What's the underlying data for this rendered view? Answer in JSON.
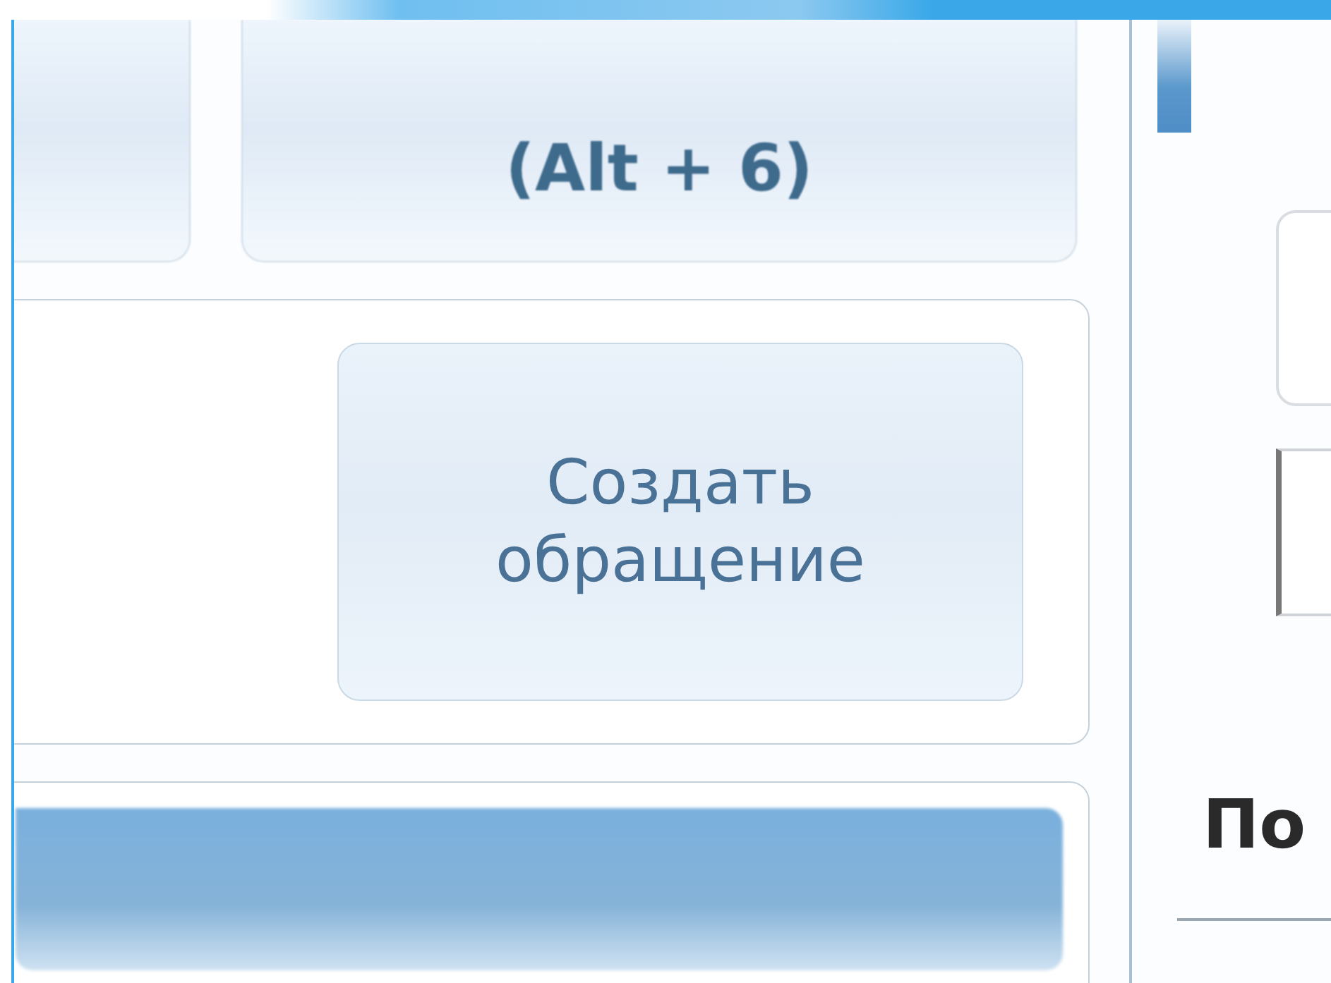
{
  "toolbar_button": "(Alt + 6)",
  "action_panel": {
    "button": "Создать обращение"
  },
  "side_panel": {
    "heading": "По"
  }
}
